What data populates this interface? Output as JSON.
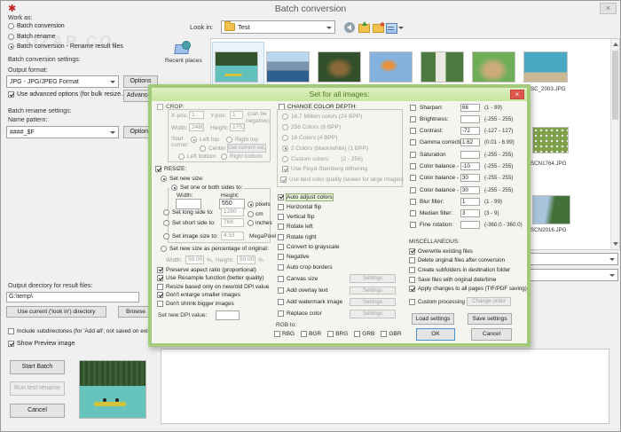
{
  "colors": {
    "dialog_green_border": "#a2ca7a",
    "dialog_green_title_bg": "#cfe8ab",
    "dialog_title_text": "#4c7e22",
    "close_red": "#e0574e",
    "selection_blue": "#cde4f7"
  },
  "icons": {
    "app": "✱",
    "window_close": "×",
    "dialog_close": "×"
  },
  "watermark": "OZAR.CO",
  "window": {
    "title": "Batch conversion"
  },
  "left": {
    "work_as": "Work as:",
    "modes": [
      {
        "label": "Batch conversion",
        "on": false
      },
      {
        "label": "Batch rename",
        "on": false
      },
      {
        "label": "Batch conversion - Rename result files",
        "on": true
      }
    ],
    "conv_settings": "Batch conversion settings:",
    "output_format": "Output format:",
    "format_value": "JPG - JPG/JPEG Format",
    "options1": "Options",
    "use_advanced": {
      "label": "Use advanced options (for bulk resize...)",
      "on": true
    },
    "advanced": "Advanced",
    "rename_settings": "Batch rename settings:",
    "name_pattern": "Name pattern:",
    "pattern_value": "####_$F",
    "options2": "Options",
    "output_dir": "Output directory for result files:",
    "dir_value": "G:\\temp\\",
    "use_current": "Use current ('look in') directory",
    "browse": "Browse",
    "include_sub": {
      "label": "Include subdirectories (for 'Add all'; not saved on exit)",
      "on": false
    },
    "show_preview": {
      "label": "Show Preview image",
      "on": true
    },
    "start_batch": "Start Batch",
    "run_test": "Run test rename",
    "cancel": "Cancel"
  },
  "browser": {
    "look_in": "Look in:",
    "folder": "Test",
    "recent_places": "Recent places",
    "file_labels": [
      "SC_2003.JPG",
      "SCN1764.JPG",
      "SCN2016.JPG"
    ]
  },
  "dlg": {
    "title": "Set for all images:",
    "crop": {
      "label": "CROP:",
      "xpos": "X-pos:",
      "xval": "1",
      "ypos": "Y-pos:",
      "yval": "1",
      "note1": "(can be",
      "note2": "negative)",
      "width": "Width:",
      "wval": "2480",
      "height": "Height:",
      "hval": "1753",
      "start1": "Start",
      "start2": "corner:",
      "lt": "Left top",
      "rt": "Right top",
      "ctr": "Center",
      "lb": "Left bottom",
      "rb": "Right bottom",
      "getsel": "Get current sel."
    },
    "resize": {
      "label": "RESIZE:",
      "new_size": "Set new size:",
      "one_both": "Set one or both sides to:",
      "w": "Width:",
      "h": "Height:",
      "wval": "",
      "hval": "550",
      "units": [
        {
          "label": "pixels",
          "on": true
        },
        {
          "label": "cm",
          "on": false
        },
        {
          "label": "inches",
          "on": false
        }
      ],
      "long": "Set long side to:",
      "longval": "1280",
      "short": "Set short side to:",
      "shortval": "768",
      "imgsize": "Set image size to:",
      "sizeval": "4.53",
      "mp": "MegaPixel",
      "pct": "Set new size as percentage of original:",
      "pw": "Width:",
      "pwval": "50.00",
      "ppct1": "%,",
      "ph": "Height:",
      "phval": "50.00",
      "ppct2": "%"
    },
    "resize_opts": [
      {
        "label": "Preserve aspect ratio (proportional)",
        "on": true
      },
      {
        "label": "Use Resample function (better quality)",
        "on": true
      },
      {
        "label": "Resize based only on new/old DPI value",
        "on": false
      },
      {
        "label": "Don't enlarge smaller images",
        "on": true
      },
      {
        "label": "Don't shrink bigger images",
        "on": false
      }
    ],
    "dpi": "Set new DPI value:",
    "depth": {
      "label": "CHANGE COLOR DEPTH:",
      "opts": [
        {
          "label": "16,7 Million colors (24 BPP)",
          "on": false,
          "extra": ""
        },
        {
          "label": "256 Colors (8 BPP)",
          "on": false,
          "extra": ""
        },
        {
          "label": "16 Colors (4 BPP)",
          "on": false,
          "extra": ""
        },
        {
          "label": "2 Colors (black/white) (1 BPP)",
          "on": true,
          "extra": ""
        },
        {
          "label": "Custom colors:",
          "on": false,
          "extra": "(2 - 256)"
        }
      ],
      "dither": {
        "label": "Use Floyd-Steinberg dithering",
        "on": true
      },
      "best": {
        "label": "Use best color quality (slower for large images)",
        "on": true
      }
    },
    "transforms": [
      {
        "label": "Auto adjust colors",
        "on": true,
        "focus": true
      },
      {
        "label": "Horizontal flip",
        "on": false
      },
      {
        "label": "Vertical flip",
        "on": false
      },
      {
        "label": "Rotate left",
        "on": false
      },
      {
        "label": "Rotate right",
        "on": false
      },
      {
        "label": "Convert to grayscale",
        "on": false
      },
      {
        "label": "Negative",
        "on": false
      },
      {
        "label": "Auto crop borders",
        "on": false
      }
    ],
    "with_settings": [
      {
        "label": "Canvas size",
        "btn": "Settings"
      },
      {
        "label": "Add overlay text",
        "btn": "Settings"
      },
      {
        "label": "Add watermark image",
        "btn": "Settings"
      },
      {
        "label": "Replace color",
        "btn": "Settings"
      }
    ],
    "rgb_to": "RGB to:",
    "rgb": [
      {
        "label": "RBG"
      },
      {
        "label": "BGR"
      },
      {
        "label": "BRG"
      },
      {
        "label": "GRB"
      },
      {
        "label": "GBR"
      }
    ],
    "adjust": [
      {
        "label": "Sharpen:",
        "val": "66",
        "range": "(1  -  99)"
      },
      {
        "label": "Brightness:",
        "val": "",
        "range": "(-255  -  255)"
      },
      {
        "label": "Contrast:",
        "val": "-72",
        "range": "(-127  -  127)"
      },
      {
        "label": "Gamma correction:",
        "val": "1.62",
        "range": "(0.01  -  6.99)"
      },
      {
        "label": "Saturation",
        "val": "",
        "range": "(-255  -  255)"
      },
      {
        "label": "Color balance - R:",
        "val": "-10",
        "range": "(-255  -  255)"
      },
      {
        "label": "Color balance - G:",
        "val": "30",
        "range": "(-255  -  255)"
      },
      {
        "label": "Color balance - B:",
        "val": "30",
        "range": "(-255  -  255)"
      },
      {
        "label": "Blur filter:",
        "val": "1",
        "range": "(1  -  99)"
      },
      {
        "label": "Median filter:",
        "val": "3",
        "range": "(3  -  9)"
      },
      {
        "label": "Fine rotation:",
        "val": "",
        "range": "(-360.0  -  360.0)"
      }
    ],
    "misc_label": "MISCELLANEOUS:",
    "misc": [
      {
        "label": "Overwrite existing files",
        "on": true
      },
      {
        "label": "Delete original files after conversion",
        "on": false
      },
      {
        "label": "Create subfolders in destination folder",
        "on": false
      },
      {
        "label": "Save files with original date/time",
        "on": false
      },
      {
        "label": "Apply changes to all pages (TIF/PDF saving)",
        "on": true
      }
    ],
    "custom_order": {
      "label": "Custom processing order",
      "on": false
    },
    "change_order": "Change order",
    "load": "Load settings",
    "save": "Save settings",
    "ok": "OK",
    "cancel": "Cancel"
  }
}
